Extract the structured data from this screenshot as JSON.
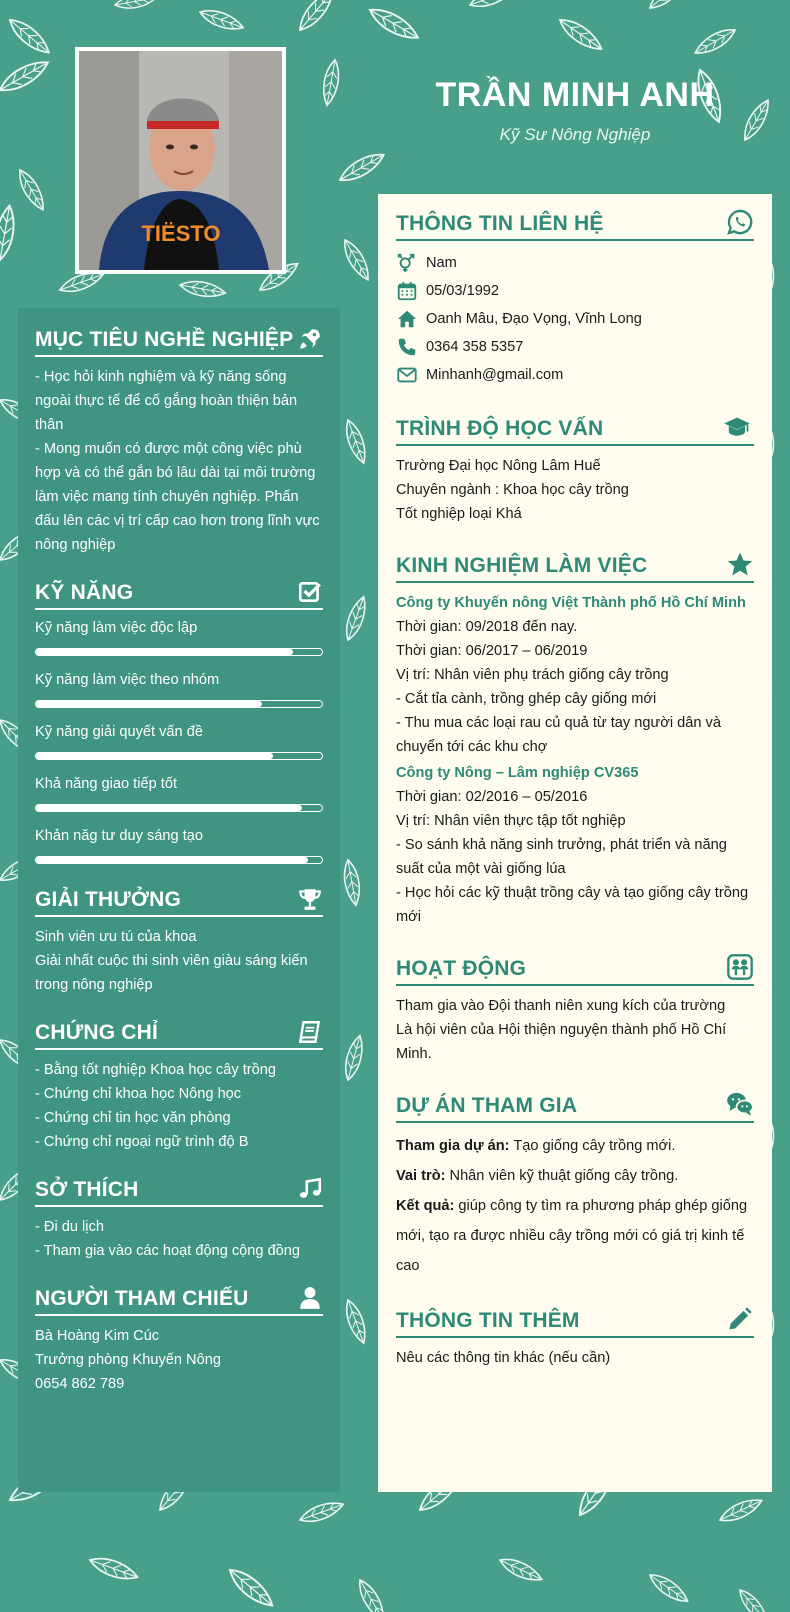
{
  "header": {
    "name": "TRẦN MINH ANH",
    "job_title": "Kỹ Sư Nông Nghiệp"
  },
  "colors": {
    "background": "#48a08b",
    "left_panel": "#3f9581",
    "right_panel": "#fdfcef",
    "accent": "#2e8a77"
  },
  "left": {
    "objective": {
      "title": "MỤC TIÊU NGHỀ NGHIỆP",
      "icon": "rocket-icon",
      "lines": [
        "- Học hỏi kinh nghiệm và kỹ năng sống ngoài thực tế để cố gắng hoàn thiện bản thân",
        "- Mong muốn có được một công việc phù hợp và có thể gắn bó lâu dài tại môi trường làm việc mang tính chuyên nghiệp. Phấn đấu lên các vị trí cấp cao hơn trong lĩnh vực nông nghiệp"
      ]
    },
    "skills": {
      "title": "KỸ NĂNG",
      "icon": "checkbox-icon",
      "items": [
        {
          "label": "Kỹ năng làm việc độc lập",
          "level": 0.9
        },
        {
          "label": "Kỹ năng làm việc theo nhóm",
          "level": 0.79
        },
        {
          "label": "Kỹ năng giải quyết vấn đề",
          "level": 0.83
        },
        {
          "label": "Khả năng giao tiếp tốt",
          "level": 0.93
        },
        {
          "label": "Khản năg tư duy sáng tạo",
          "level": 0.95
        }
      ]
    },
    "awards": {
      "title": "GIẢI THƯỞNG",
      "icon": "trophy-icon",
      "lines": [
        "Sinh viên ưu tú của khoa",
        "Giải nhất cuộc thi sinh viên giàu sáng kiến trong nông nghiệp"
      ]
    },
    "certificates": {
      "title": "CHỨNG CHỈ",
      "icon": "book-icon",
      "lines": [
        "- Bằng tốt nghiệp Khoa học cây trồng",
        "- Chứng chỉ khoa học Nông học",
        "- Chứng chỉ tin học văn phòng",
        "- Chứng chỉ ngoại ngữ trình độ B"
      ]
    },
    "hobbies": {
      "title": "SỞ THÍCH",
      "icon": "music-icon",
      "lines": [
        "- Đi du lịch",
        "- Tham gia vào các hoạt động cộng đồng"
      ]
    },
    "references": {
      "title": "NGƯỜI THAM CHIẾU",
      "icon": "user-icon",
      "lines": [
        "Bà Hoàng Kim Cúc",
        "Trưởng phòng Khuyến Nông",
        "0654 862 789"
      ]
    }
  },
  "right": {
    "contact": {
      "title": "THÔNG TIN LIÊN HỆ",
      "icon": "whatsapp-icon",
      "items": [
        {
          "icon": "gender-icon",
          "value": "Nam"
        },
        {
          "icon": "calendar-icon",
          "value": "05/03/1992"
        },
        {
          "icon": "home-icon",
          "value": "Oanh Mâu, Đạo Vọng, Vĩnh Long"
        },
        {
          "icon": "phone-icon",
          "value": "0364 358 5357"
        },
        {
          "icon": "envelope-icon",
          "value": "Minhanh@gmail.com"
        }
      ]
    },
    "education": {
      "title": "TRÌNH ĐỘ HỌC VẤN",
      "icon": "graduation-cap-icon",
      "lines": [
        "Trường Đại học Nông Lâm Huế",
        "Chuyên ngành : Khoa học cây trồng",
        "Tốt nghiệp loại Khá"
      ]
    },
    "experience": {
      "title": "KINH NGHIỆM LÀM VIỆC",
      "icon": "star-icon",
      "jobs": [
        {
          "company": "Công ty Khuyến nông Việt Thành phố Hồ Chí Minh",
          "lines": [
            "Thời gian: 09/2018 đến nay.",
            "Thời gian: 06/2017 – 06/2019",
            "Vị trí: Nhân viên phụ trách giống cây trồng",
            "- Cắt tỉa cành, trồng ghép cây giống mới",
            "- Thu mua các loại rau củ quả từ tay người dân và chuyển tới các khu chợ"
          ]
        },
        {
          "company": "Công ty Nông – Lâm nghiệp CV365",
          "lines": [
            "Thời gian: 02/2016 – 05/2016",
            "Vị trí: Nhân viên thực tập tốt nghiệp",
            "- So sánh khả năng sinh trưởng, phát triển và năng suất của một vài giống lúa",
            "- Học hỏi các kỹ thuật trồng cây và tạo giống cây trồng mới"
          ]
        }
      ]
    },
    "activities": {
      "title": "HOẠT ĐỘNG",
      "icon": "group-icon",
      "lines": [
        "Tham gia vào Đội thanh niên xung kích của trường",
        "Là hội viên của Hội thiện nguyện thành phố Hồ Chí Minh."
      ]
    },
    "projects": {
      "title": "DỰ ÁN THAM GIA",
      "icon": "chat-icon",
      "items": [
        {
          "label": "Tham gia dự án:",
          "value": " Tạo giống cây trồng mới."
        },
        {
          "label": "Vai trò:",
          "value": " Nhân viên kỹ thuật giống cây trồng."
        },
        {
          "label": "Kết quả:",
          "value": " giúp công ty tìm ra phương pháp ghép giống mới, tạo ra được nhiều cây trồng mới có giá trị kinh tế cao"
        }
      ]
    },
    "extra": {
      "title": "THÔNG TIN THÊM",
      "icon": "pencil-icon",
      "lines": [
        "Nêu các thông tin khác (nếu cần)"
      ]
    }
  }
}
